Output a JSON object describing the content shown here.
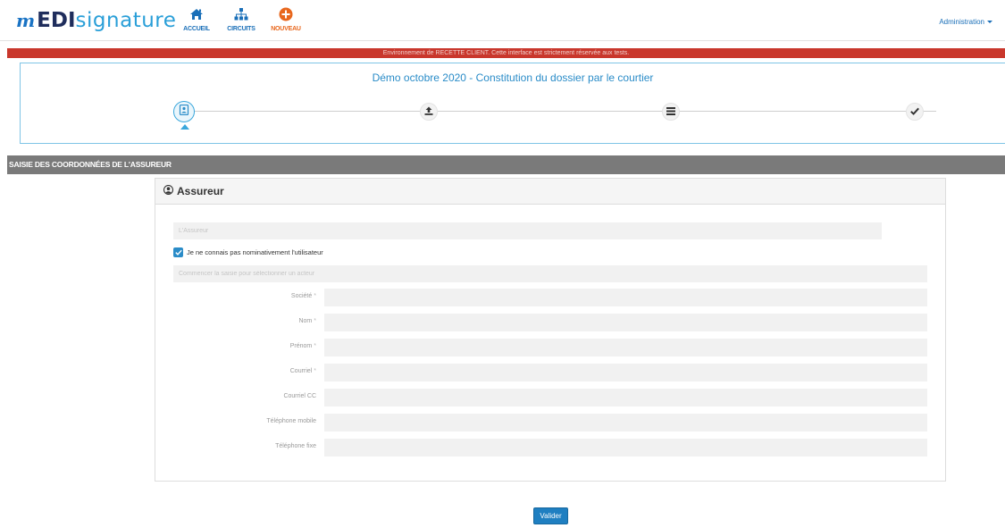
{
  "app": {
    "logo_mark": "m",
    "logo_edi": "EDI",
    "logo_signature": "signature"
  },
  "nav": {
    "items": [
      {
        "label": "ACCUEIL",
        "icon": "home-icon"
      },
      {
        "label": "CIRCUITS",
        "icon": "sitemap-icon"
      },
      {
        "label": "NOUVEAU",
        "icon": "plus-circle-icon"
      }
    ],
    "admin_label": "Administration"
  },
  "banner": {
    "text": "Environnement de RECETTE CLIENT. Cette interface est strictement réservée aux tests."
  },
  "wizard": {
    "title": "Démo octobre 2020 - Constitution du dossier par le courtier",
    "steps": [
      {
        "icon": "user-card-icon",
        "active": true
      },
      {
        "icon": "upload-icon",
        "active": false
      },
      {
        "icon": "list-icon",
        "active": false
      },
      {
        "icon": "check-icon",
        "active": false
      }
    ]
  },
  "section": {
    "title": "SAISIE DES COORDONNÉES DE L'ASSUREUR"
  },
  "panel": {
    "title": "Assureur",
    "assureur_placeholder": "L'Assureur",
    "checkbox_label": "Je ne connais pas nominativement l'utilisateur",
    "checkbox_checked": true,
    "search_placeholder": "Commencer la saisie pour sélectionner un acteur",
    "fields": [
      {
        "label": "Société",
        "required": true,
        "value": ""
      },
      {
        "label": "Nom",
        "required": true,
        "value": ""
      },
      {
        "label": "Prénom",
        "required": true,
        "value": ""
      },
      {
        "label": "Courriel",
        "required": true,
        "value": ""
      },
      {
        "label": "Courriel CC",
        "required": false,
        "value": ""
      },
      {
        "label": "Téléphone mobile",
        "required": false,
        "value": ""
      },
      {
        "label": "Téléphone fixe",
        "required": false,
        "value": ""
      }
    ],
    "required_mark": "*"
  },
  "actions": {
    "submit_label": "Valider"
  },
  "colors": {
    "primary": "#1f7fc1",
    "accent_orange": "#e8671d",
    "banner_red": "#c9372c",
    "section_grey": "#7a7a7a"
  }
}
